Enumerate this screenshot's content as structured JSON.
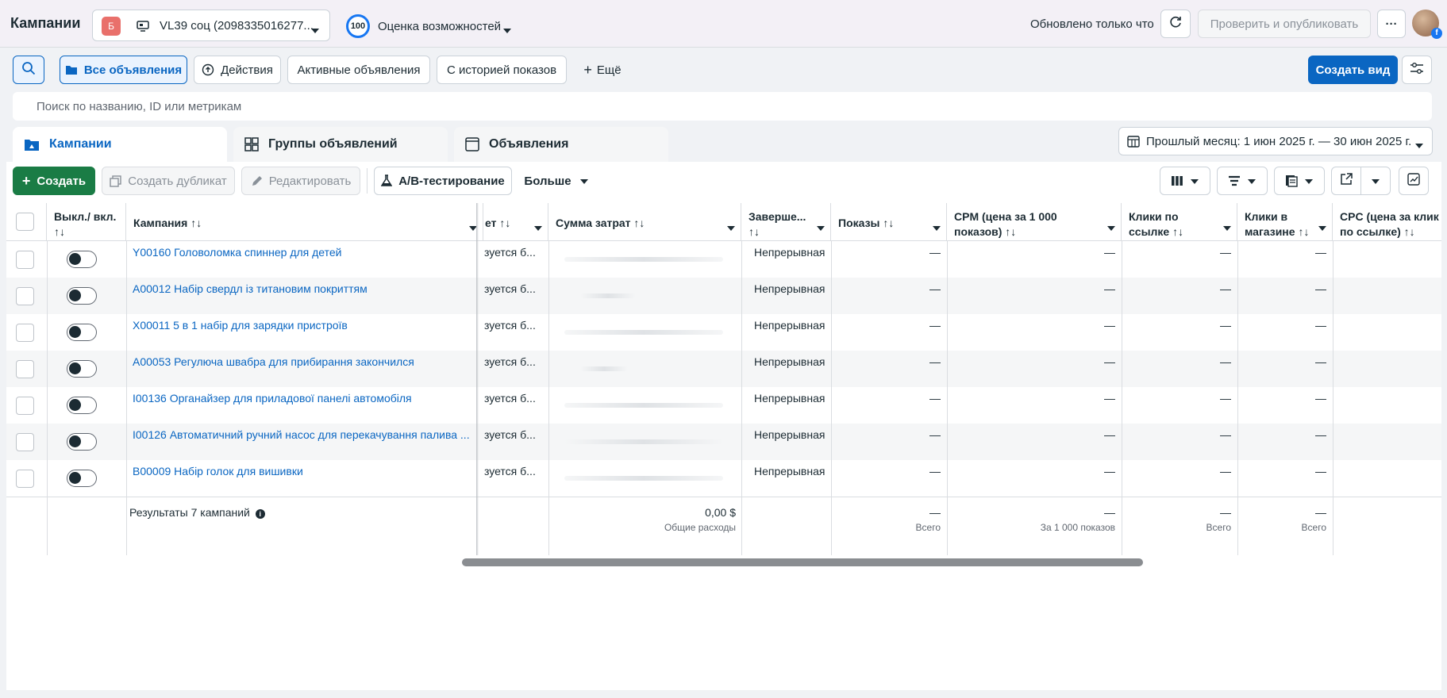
{
  "topbar": {
    "title": "Кампании",
    "account_badge": "Б",
    "account_name": "VL39 соц (2098335016277...",
    "score": "100",
    "opportunity_label": "Оценка возможностей",
    "updated": "Обновлено только что",
    "publish_label": "Проверить и опубликовать",
    "more": "···"
  },
  "filters": {
    "all_ads": "Все объявления",
    "actions": "Действия",
    "active_ads": "Активные объявления",
    "with_history": "С историей показов",
    "more": "Ещё",
    "create_view": "Создать вид"
  },
  "search": {
    "placeholder": "Поиск по названию, ID или метрикам"
  },
  "tabs": {
    "campaigns": "Кампании",
    "adsets": "Группы объявлений",
    "ads": "Объявления"
  },
  "date_range": "Прошлый месяц: 1 июн 2025 г. — 30 июн 2025 г.",
  "toolbar": {
    "create": "Создать",
    "duplicate": "Создать дубликат",
    "edit": "Редактировать",
    "ab_test": "A/B-тестирование",
    "more": "Больше"
  },
  "columns": {
    "toggle": "Выкл./ вкл. ↑↓",
    "campaign": "Кампания ↑↓",
    "budget": "ет ↑↓",
    "spend": "Сумма затрат ↑↓",
    "ends": "Заверше... ↑↓",
    "impressions": "Показы ↑↓",
    "cpm": "CPM (цена за 1 000 показов) ↑↓",
    "link_clicks": "Клики по ссылке ↑↓",
    "shop_clicks": "Клики в магазине ↑↓",
    "cpc": "CPC (цена за клик по ссылке) ↑↓"
  },
  "rows": [
    {
      "name": "Y00160 Головоломка спиннер для детей",
      "budget": "зуется б...",
      "ends": "Непрерывная",
      "impressions": "—",
      "cpm": "—",
      "link_clicks": "—",
      "shop_clicks": "—"
    },
    {
      "name": "A00012 Набір свердл із титановим покриттям",
      "budget": "зуется б...",
      "ends": "Непрерывная",
      "impressions": "—",
      "cpm": "—",
      "link_clicks": "—",
      "shop_clicks": "—"
    },
    {
      "name": "X00011 5 в 1 набір для зарядки пристроїв",
      "budget": "зуется б...",
      "ends": "Непрерывная",
      "impressions": "—",
      "cpm": "—",
      "link_clicks": "—",
      "shop_clicks": "—"
    },
    {
      "name": "A00053 Регулюча швабра для прибирання закончился",
      "budget": "зуется б...",
      "ends": "Непрерывная",
      "impressions": "—",
      "cpm": "—",
      "link_clicks": "—",
      "shop_clicks": "—"
    },
    {
      "name": "I00136 Органайзер для приладової панелі автомобіля",
      "budget": "зуется б...",
      "ends": "Непрерывная",
      "impressions": "—",
      "cpm": "—",
      "link_clicks": "—",
      "shop_clicks": "—"
    },
    {
      "name": "I00126 Автоматичний ручний насос для перекачування палива ...",
      "budget": "зуется б...",
      "ends": "Непрерывная",
      "impressions": "—",
      "cpm": "—",
      "link_clicks": "—",
      "shop_clicks": "—"
    },
    {
      "name": "B00009 Набір голок для вишивки",
      "budget": "зуется б...",
      "ends": "Непрерывная",
      "impressions": "—",
      "cpm": "—",
      "link_clicks": "—",
      "shop_clicks": "—"
    }
  ],
  "footer": {
    "results": "Результаты 7 кампаний",
    "spend": "0,00 $",
    "spend_sub": "Общие расходы",
    "impressions": "—",
    "impressions_sub": "Всего",
    "cpm": "—",
    "cpm_sub": "За 1 000 показов",
    "link_clicks": "—",
    "link_clicks_sub": "Всего",
    "shop_clicks": "—",
    "shop_clicks_sub": "Всего"
  }
}
